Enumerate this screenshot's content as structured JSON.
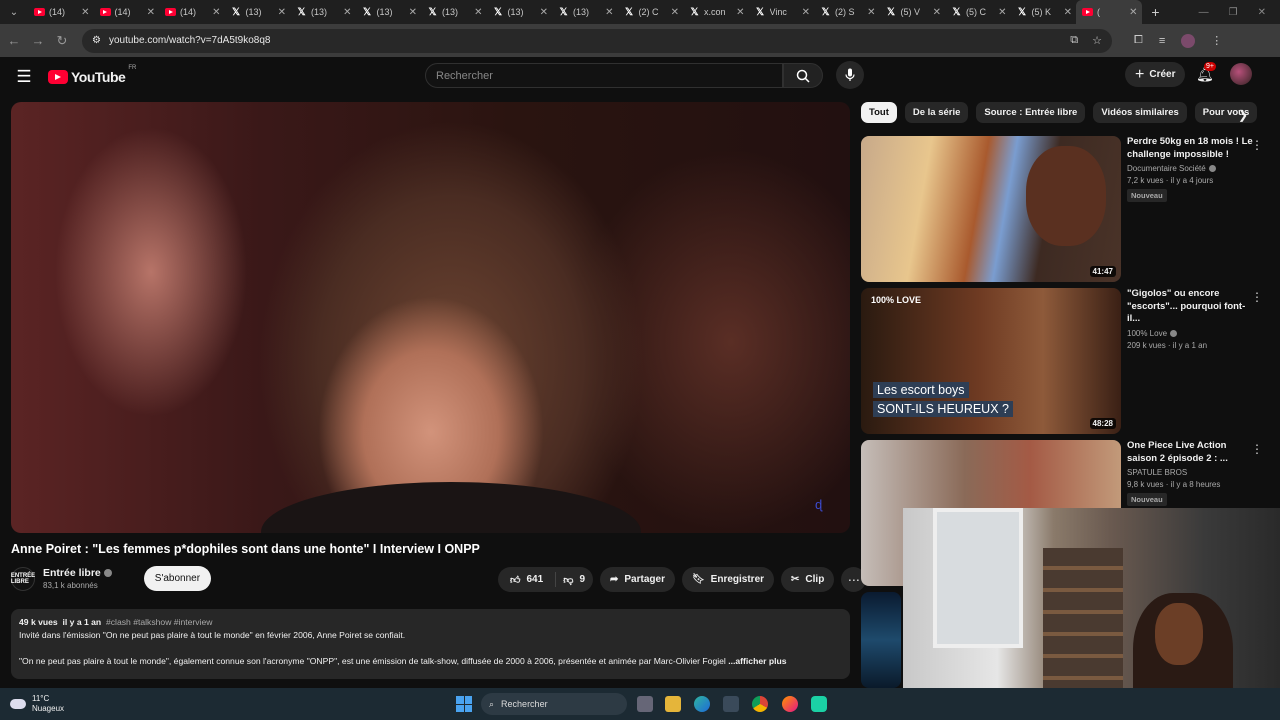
{
  "browser": {
    "tabs": [
      {
        "icon": "youtube",
        "label": "(14)"
      },
      {
        "icon": "youtube",
        "label": "(14)"
      },
      {
        "icon": "youtube",
        "label": "(14)"
      },
      {
        "icon": "x",
        "label": "(13)"
      },
      {
        "icon": "x",
        "label": "(13)"
      },
      {
        "icon": "x",
        "label": "(13)"
      },
      {
        "icon": "x",
        "label": "(13)"
      },
      {
        "icon": "x",
        "label": "(13)"
      },
      {
        "icon": "x",
        "label": "(13)"
      },
      {
        "icon": "x",
        "label": "(2) C"
      },
      {
        "icon": "x",
        "label": "x.con"
      },
      {
        "icon": "x",
        "label": "Vinc"
      },
      {
        "icon": "x",
        "label": "(2) S"
      },
      {
        "icon": "x",
        "label": "(5) V"
      },
      {
        "icon": "x",
        "label": "(5) C"
      },
      {
        "icon": "x",
        "label": "(5) K"
      },
      {
        "icon": "youtube",
        "label": "("
      }
    ],
    "url": "youtube.com/watch?v=7dA5t9ko8q8"
  },
  "header": {
    "logo_text": "YouTube",
    "country_code": "FR",
    "search_placeholder": "Rechercher",
    "create_label": "Créer",
    "notifications_badge": "9+"
  },
  "video": {
    "title": "Anne Poiret : \"Les femmes p*dophiles sont dans une honte\" I Interview I ONPP",
    "channel_name": "Entrée libre",
    "channel_avatar_text": "ENTRÉE LIBRE",
    "subscribers": "83,1 k abonnés",
    "subscribe_label": "S'abonner",
    "likes": "641",
    "dislikes": "9",
    "share_label": "Partager",
    "save_label": "Enregistrer",
    "clip_label": "Clip",
    "watermark": "ɖ"
  },
  "description": {
    "views": "49 k vues",
    "age": "il y a 1 an",
    "tags": "#clash #talkshow #interview",
    "line1": "Invité dans l'émission \"On ne peut pas plaire à tout le monde\" en février 2006, Anne Poiret se confiait.",
    "line2": "\"On ne peut pas plaire à tout le monde\", également connue son l'acronyme \"ONPP\", est une émission de talk-show, diffusée de 2000 à 2006, présentée et animée par Marc-Olivier Fogiel",
    "more_label": "...afficher plus"
  },
  "chips": [
    "Tout",
    "De la série",
    "Source : Entrée libre",
    "Vidéos similaires",
    "Pour vous"
  ],
  "recommendations": [
    {
      "title": "Perdre 50kg en 18 mois ! Le challenge impossible !",
      "channel": "Documentaire Société",
      "meta": "7,2 k vues · il y a 4 jours",
      "badge": "Nouveau",
      "duration": "41:47"
    },
    {
      "title": "\"Gigolos\" ou encore \"escorts\"... pourquoi font-il...",
      "channel": "100% Love",
      "meta": "209 k vues · il y a 1 an",
      "badge": "",
      "duration": "48:28",
      "caption1": "Les escort boys",
      "caption2": "SONT-ILS HEUREUX ?",
      "logo": "100% LOVE"
    },
    {
      "title": "One Piece Live Action saison 2 épisode 2 : ...",
      "channel": "SPATULE BROS",
      "meta": "9,8 k vues · il y a 8 heures",
      "badge": "Nouveau",
      "duration": ""
    }
  ],
  "taskbar": {
    "temperature": "11°C",
    "weather": "Nuageux",
    "search_label": "Rechercher"
  }
}
